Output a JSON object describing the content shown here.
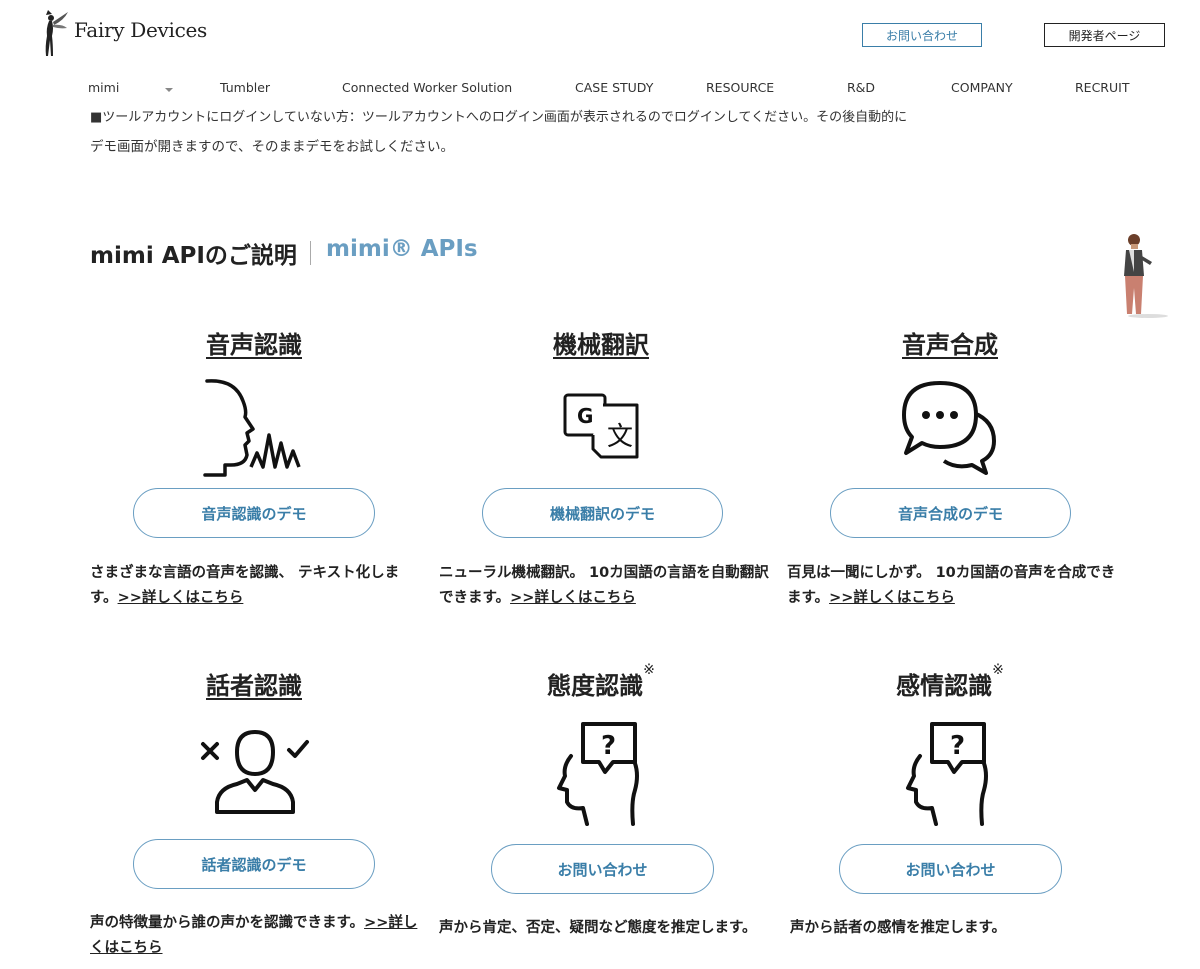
{
  "header": {
    "logo_text": "Fairy Devices",
    "contact_label": "お問い合わせ",
    "developer_label": "開発者ページ"
  },
  "nav": [
    "mimi",
    "Tumbler",
    "Connected Worker Solution",
    "CASE STUDY",
    "RESOURCE",
    "R&D",
    "COMPANY",
    "RECRUIT"
  ],
  "intro": {
    "line1": "■ツールアカウントにログインしていない方：ツールアカウントへのログイン画面が表示されるのでログインしてください。その後自動的に",
    "line2": "デモ画面が開きますので、そのままデモをお試しください。"
  },
  "section": {
    "title": "mimi APIのご説明",
    "subtitle": "mimi® APIs"
  },
  "cards": [
    {
      "title": "音声認識",
      "icon": "speaking-head-icon",
      "button": "音声認識のデモ",
      "desc": "さまざまな言語の音声を認識、 テキスト化します。",
      "link": ">>詳しくはこちら"
    },
    {
      "title": "機械翻訳",
      "icon": "translate-icon",
      "button": "機械翻訳のデモ",
      "desc": "ニューラル機械翻訳。 10カ国語の言語を自動翻訳できます。",
      "link": ">>詳しくはこちら"
    },
    {
      "title": "音声合成",
      "icon": "speech-bubbles-icon",
      "button": "音声合成のデモ",
      "desc": "百見は一聞にしかず。 10カ国語の音声を合成できます。",
      "link": ">>詳しくはこちら"
    },
    {
      "title": "話者認識",
      "icon": "speaker-identify-icon",
      "button": "話者認識のデモ",
      "desc": "声の特徴量から誰の声かを認識できます。",
      "link": ">>詳しくはこちら"
    },
    {
      "title": "態度認識",
      "mark": "※",
      "icon": "question-head-icon",
      "button": "お問い合わせ",
      "desc": "声から肯定、否定、疑問など態度を推定します。"
    },
    {
      "title": "感情認識",
      "mark": "※",
      "icon": "question-head-icon",
      "button": "お問い合わせ",
      "desc": "声から話者の感情を推定します。"
    }
  ]
}
